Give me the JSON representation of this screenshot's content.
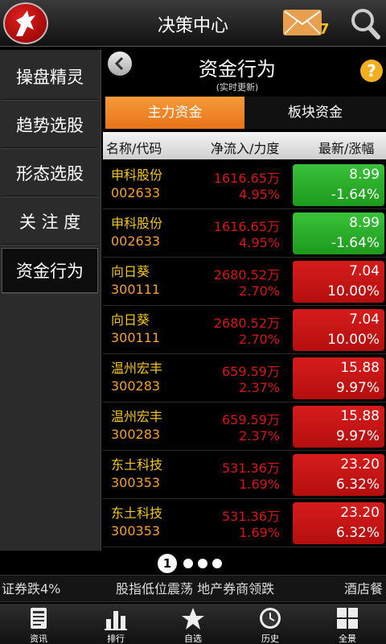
{
  "header": {
    "title": "决策中心",
    "mail_count": "7",
    "logo_icon": "horse-logo-icon",
    "mail_icon": "envelope-icon",
    "search_icon": "magnifier-icon"
  },
  "sidebar": {
    "items": [
      {
        "label": "操盘精灵"
      },
      {
        "label": "趋势选股"
      },
      {
        "label": "形态选股"
      },
      {
        "label": "关 注 度"
      },
      {
        "label": "资金行为"
      }
    ],
    "active_index": 4
  },
  "content": {
    "title": "资金行为",
    "subtitle": "(实时更新)",
    "help_label": "?"
  },
  "tabs": [
    {
      "label": "主力资金",
      "active": true
    },
    {
      "label": "板块资金",
      "active": false
    }
  ],
  "columns": {
    "name_code": "名称/代码",
    "flow_force": "净流入/力度",
    "price_change": "最新/涨幅"
  },
  "rows": [
    {
      "name": "申科股份",
      "code": "002633",
      "flow": "1616.65万",
      "force": "4.95%",
      "price": "8.99",
      "change": "-1.64%",
      "trend": "down"
    },
    {
      "name": "申科股份",
      "code": "002633",
      "flow": "1616.65万",
      "force": "4.95%",
      "price": "8.99",
      "change": "-1.64%",
      "trend": "down"
    },
    {
      "name": "向日葵",
      "code": "300111",
      "flow": "2680.52万",
      "force": "2.70%",
      "price": "7.04",
      "change": "10.00%",
      "trend": "up"
    },
    {
      "name": "向日葵",
      "code": "300111",
      "flow": "2680.52万",
      "force": "2.70%",
      "price": "7.04",
      "change": "10.00%",
      "trend": "up"
    },
    {
      "name": "温州宏丰",
      "code": "300283",
      "flow": "659.59万",
      "force": "2.37%",
      "price": "15.88",
      "change": "9.97%",
      "trend": "up"
    },
    {
      "name": "温州宏丰",
      "code": "300283",
      "flow": "659.59万",
      "force": "2.37%",
      "price": "15.88",
      "change": "9.97%",
      "trend": "up"
    },
    {
      "name": "东土科技",
      "code": "300353",
      "flow": "531.36万",
      "force": "1.69%",
      "price": "23.20",
      "change": "6.32%",
      "trend": "up"
    },
    {
      "name": "东土科技",
      "code": "300353",
      "flow": "531.36万",
      "force": "1.69%",
      "price": "23.20",
      "change": "6.32%",
      "trend": "up"
    }
  ],
  "pager": {
    "current": "1",
    "total": 4
  },
  "ticker": {
    "items": [
      "证券跌4%",
      "股指低位震荡 地产券商领跌",
      "酒店餐"
    ]
  },
  "bottom_nav": [
    {
      "label": "资讯",
      "icon": "news-icon"
    },
    {
      "label": "排行",
      "icon": "ranking-icon"
    },
    {
      "label": "自选",
      "icon": "star-icon"
    },
    {
      "label": "历史",
      "icon": "clock-icon"
    },
    {
      "label": "全景",
      "icon": "grid-icon"
    }
  ],
  "colors": {
    "accent_orange": "#e87418",
    "up_red": "#c41212",
    "down_green": "#2aaa2a",
    "stock_name": "#f5c518"
  }
}
